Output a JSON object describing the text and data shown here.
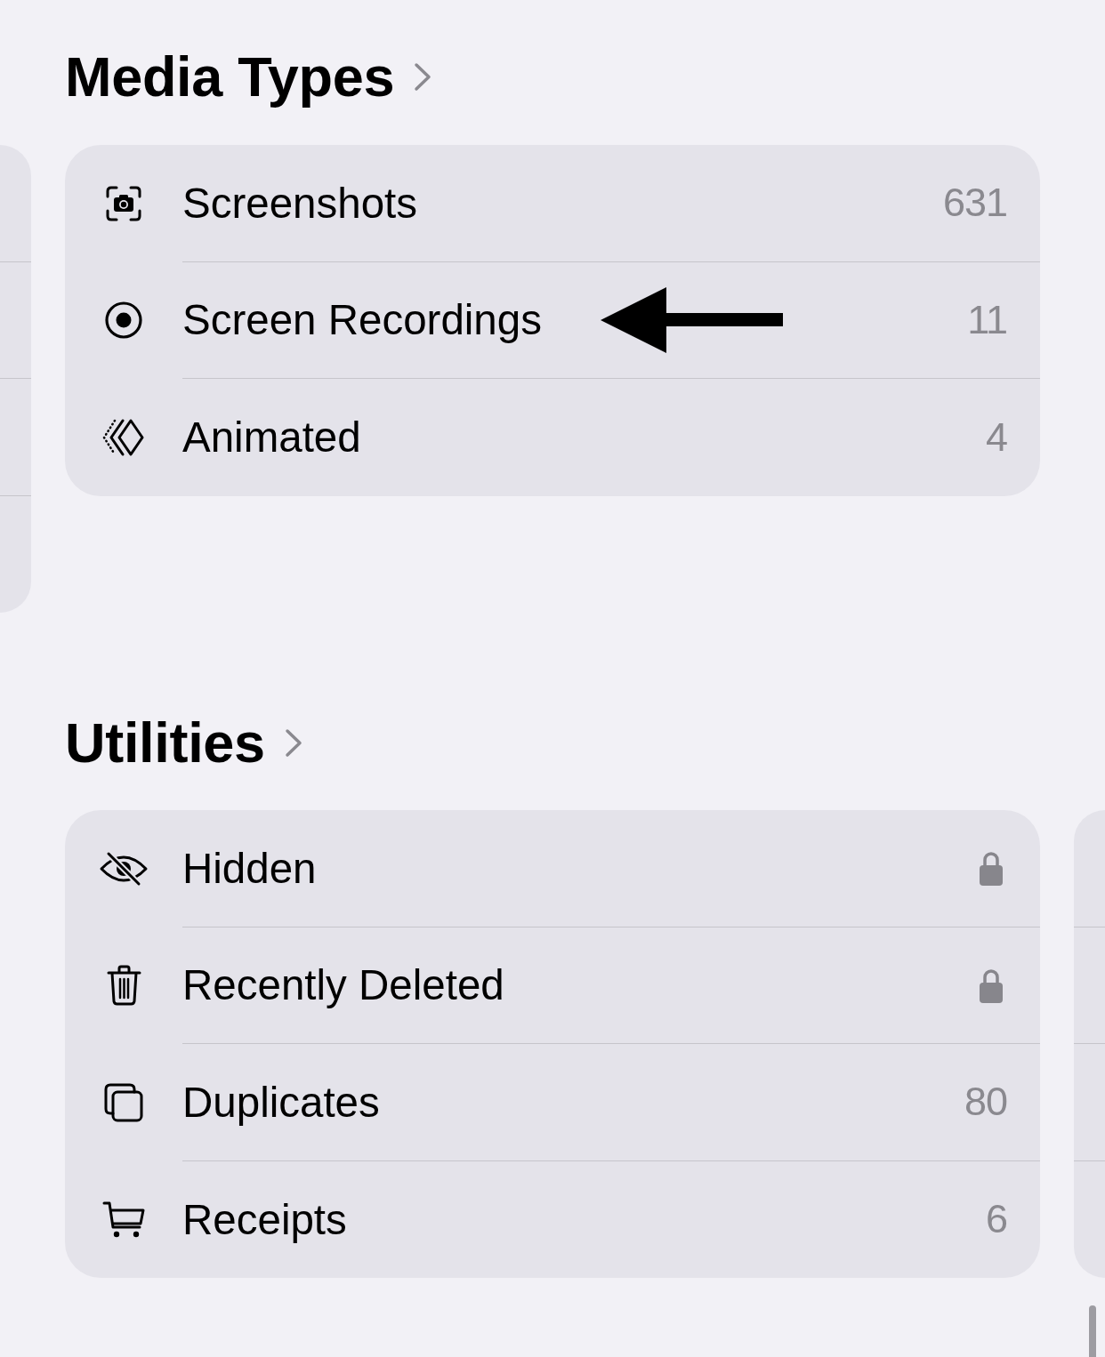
{
  "sections": [
    {
      "title": "Media Types",
      "peek_left": true,
      "peek_right": false,
      "items": [
        {
          "label": "Screenshots",
          "count": "631",
          "locked": false,
          "marked": false
        },
        {
          "label": "Screen Recordings",
          "count": "11",
          "locked": false,
          "marked": true
        },
        {
          "label": "Animated",
          "count": "4",
          "locked": false,
          "marked": false
        }
      ]
    },
    {
      "title": "Utilities",
      "peek_left": false,
      "peek_right": true,
      "items": [
        {
          "label": "Hidden",
          "locked": true,
          "marked": false
        },
        {
          "label": "Recently Deleted",
          "locked": true,
          "marked": false
        },
        {
          "label": "Duplicates",
          "count": "80",
          "locked": false,
          "marked": false
        },
        {
          "label": "Receipts",
          "count": "6",
          "locked": false,
          "marked": false
        }
      ]
    }
  ]
}
